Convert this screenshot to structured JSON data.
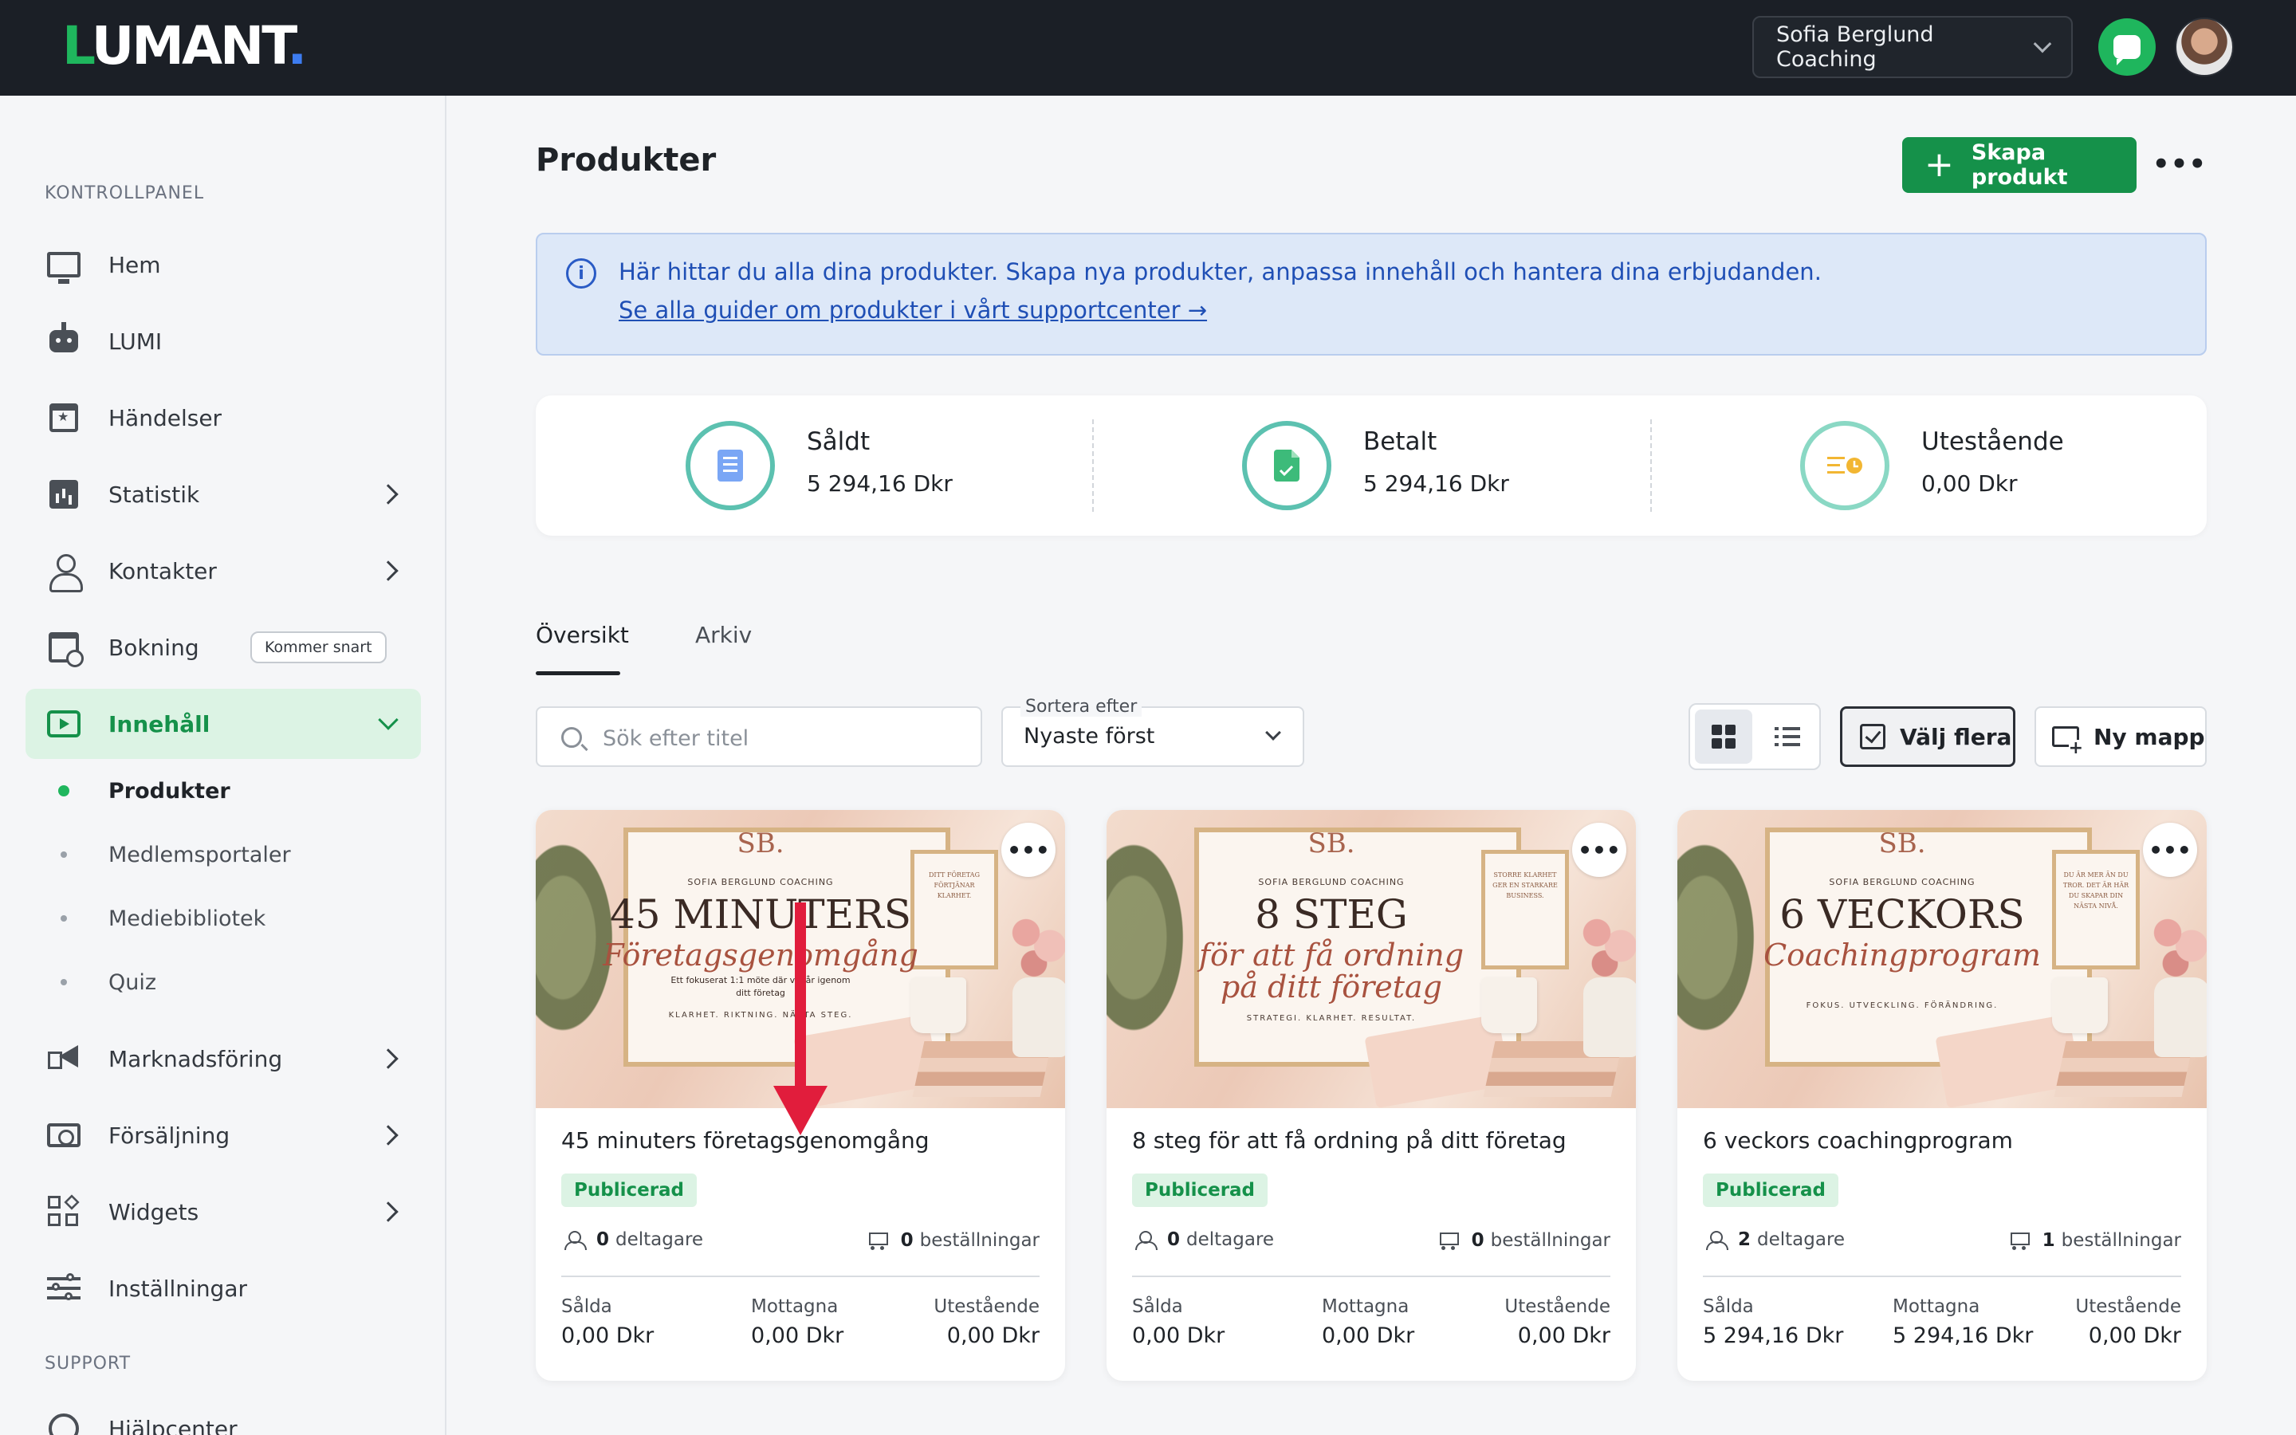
{
  "app": {
    "logo": {
      "first": "L",
      "rest": "UMANT",
      "dot": "."
    },
    "account_name": "Sofia Berglund Coaching"
  },
  "sidebar": {
    "section_main": "KONTROLLPANEL",
    "section_support": "SUPPORT",
    "items": [
      {
        "label": "Hem",
        "icon": "monitor-icon"
      },
      {
        "label": "LUMI",
        "icon": "robot-icon"
      },
      {
        "label": "Händelser",
        "icon": "calendar-star-icon"
      },
      {
        "label": "Statistik",
        "icon": "chart-icon"
      },
      {
        "label": "Kontakter",
        "icon": "person-icon"
      },
      {
        "label": "Bokning",
        "icon": "booking-icon",
        "badge": "Kommer snart"
      },
      {
        "label": "Innehåll",
        "icon": "play-icon"
      },
      {
        "label": "Marknadsföring",
        "icon": "megaphone-icon"
      },
      {
        "label": "Försäljning",
        "icon": "cash-icon"
      },
      {
        "label": "Widgets",
        "icon": "widgets-icon"
      },
      {
        "label": "Inställningar",
        "icon": "sliders-icon"
      },
      {
        "label": "Hjälpcenter",
        "icon": "help-icon"
      }
    ],
    "subitems": [
      "Produkter",
      "Medlemsportaler",
      "Mediebibliotek",
      "Quiz"
    ]
  },
  "main": {
    "title": "Produkter",
    "create_label": "Skapa produkt",
    "info_text": "Här hittar du alla dina produkter. Skapa nya produkter, anpassa innehåll och hantera dina erbjudanden.",
    "info_link": "Se alla guider om produkter i vårt supportcenter →",
    "stats": [
      {
        "title": "Såldt",
        "value": "5 294,16 Dkr"
      },
      {
        "title": "Betalt",
        "value": "5 294,16 Dkr"
      },
      {
        "title": "Utestående",
        "value": "0,00 Dkr"
      }
    ],
    "tabs": [
      "Översikt",
      "Arkiv"
    ],
    "search_placeholder": "Sök efter titel",
    "sort_label": "Sortera efter",
    "sort_value": "Nyaste först",
    "select_label": "Välj flera",
    "folder_label": "Ny mapp"
  },
  "products": [
    {
      "thumb_big": "45 MINUTERS",
      "thumb_script": "Företagsgenomgång",
      "thumb_script2": "",
      "thumb_body": "Ett fokuserat 1:1 möte där vi går igenom ditt företag",
      "thumb_tag": "KLARHET. RIKTNING. NÄSTA STEG.",
      "thumb_side": "DITT FÖRETAG FÖRTJÄNAR KLARHET.",
      "title": "45 minuters företagsgenomgång",
      "status": "Publicerad",
      "participants": "0",
      "participants_label": "deltagare",
      "orders": "0",
      "orders_label": "beställningar",
      "sold": "0,00 Dkr",
      "received": "0,00 Dkr",
      "outstanding": "0,00 Dkr"
    },
    {
      "thumb_big": "8 STEG",
      "thumb_script": "för att få ordning",
      "thumb_script2": "på ditt företag",
      "thumb_body": "",
      "thumb_tag": "STRATEGI. KLARHET. RESULTAT.",
      "thumb_side": "STORRE KLARHET GER EN STARKARE BUSINESS.",
      "title": "8 steg för att få ordning på ditt företag",
      "status": "Publicerad",
      "participants": "0",
      "participants_label": "deltagare",
      "orders": "0",
      "orders_label": "beställningar",
      "sold": "0,00 Dkr",
      "received": "0,00 Dkr",
      "outstanding": "0,00 Dkr"
    },
    {
      "thumb_big": "6 VECKORS",
      "thumb_script": "Coachingprogram",
      "thumb_script2": "",
      "thumb_body": "",
      "thumb_tag": "FOKUS. UTVECKLING. FÖRÄNDRING.",
      "thumb_side": "DU ÄR MER ÄN DU TROR. DET ÄR HÄR DU SKAPAR DIN NÄSTA NIVÅ.",
      "title": "6 veckors coachingprogram",
      "status": "Publicerad",
      "participants": "2",
      "participants_label": "deltagare",
      "orders": "1",
      "orders_label": "beställningar",
      "sold": "5 294,16 Dkr",
      "received": "5 294,16 Dkr",
      "outstanding": "0,00 Dkr"
    }
  ],
  "finance_labels": {
    "sold": "Sålda",
    "received": "Mottagna",
    "outstanding": "Utestående"
  },
  "thumb_brand": {
    "monogram": "SB.",
    "subtitle": "SOFIA BERGLUND COACHING"
  },
  "colors": {
    "accent": "#15914a",
    "brand_green": "#1fb65d",
    "info_blue": "#1f4fb5",
    "annotation_red": "#e11d3c"
  }
}
